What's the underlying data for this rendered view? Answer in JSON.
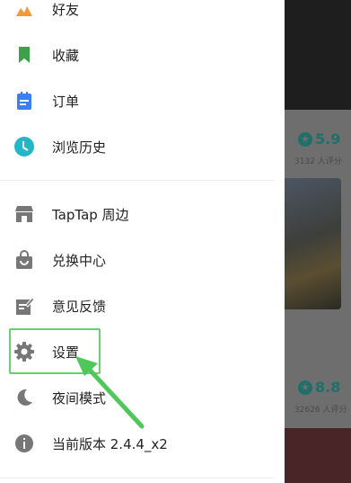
{
  "drawer": {
    "top_items": [
      {
        "label": "好友",
        "icon": "friends-icon",
        "color": "#f29a38"
      },
      {
        "label": "收藏",
        "icon": "bookmark-icon",
        "color": "#3ca14a"
      },
      {
        "label": "订单",
        "icon": "order-icon",
        "color": "#3d7ef0"
      },
      {
        "label": "浏览历史",
        "icon": "history-clock-icon",
        "color": "#23b6c6"
      }
    ],
    "bottom_items": [
      {
        "label": "TapTap 周边",
        "icon": "store-icon",
        "color": "#777777"
      },
      {
        "label": "兑换中心",
        "icon": "shopping-bag-icon",
        "color": "#777777"
      },
      {
        "label": "意见反馈",
        "icon": "feedback-edit-icon",
        "color": "#777777"
      },
      {
        "label": "设置",
        "icon": "gear-icon",
        "color": "#777777"
      },
      {
        "label": "夜间模式",
        "icon": "moon-icon",
        "color": "#777777"
      },
      {
        "label": "当前版本 2.4.4_x2",
        "icon": "info-icon",
        "color": "#777777"
      }
    ]
  },
  "annotation": {
    "highlight_color": "#66d26e",
    "target": "设置"
  },
  "background": {
    "ratings": [
      {
        "score": "5.9",
        "count": "3132 人评分"
      },
      {
        "score": "8.8",
        "count": "32626 人评分"
      }
    ]
  }
}
